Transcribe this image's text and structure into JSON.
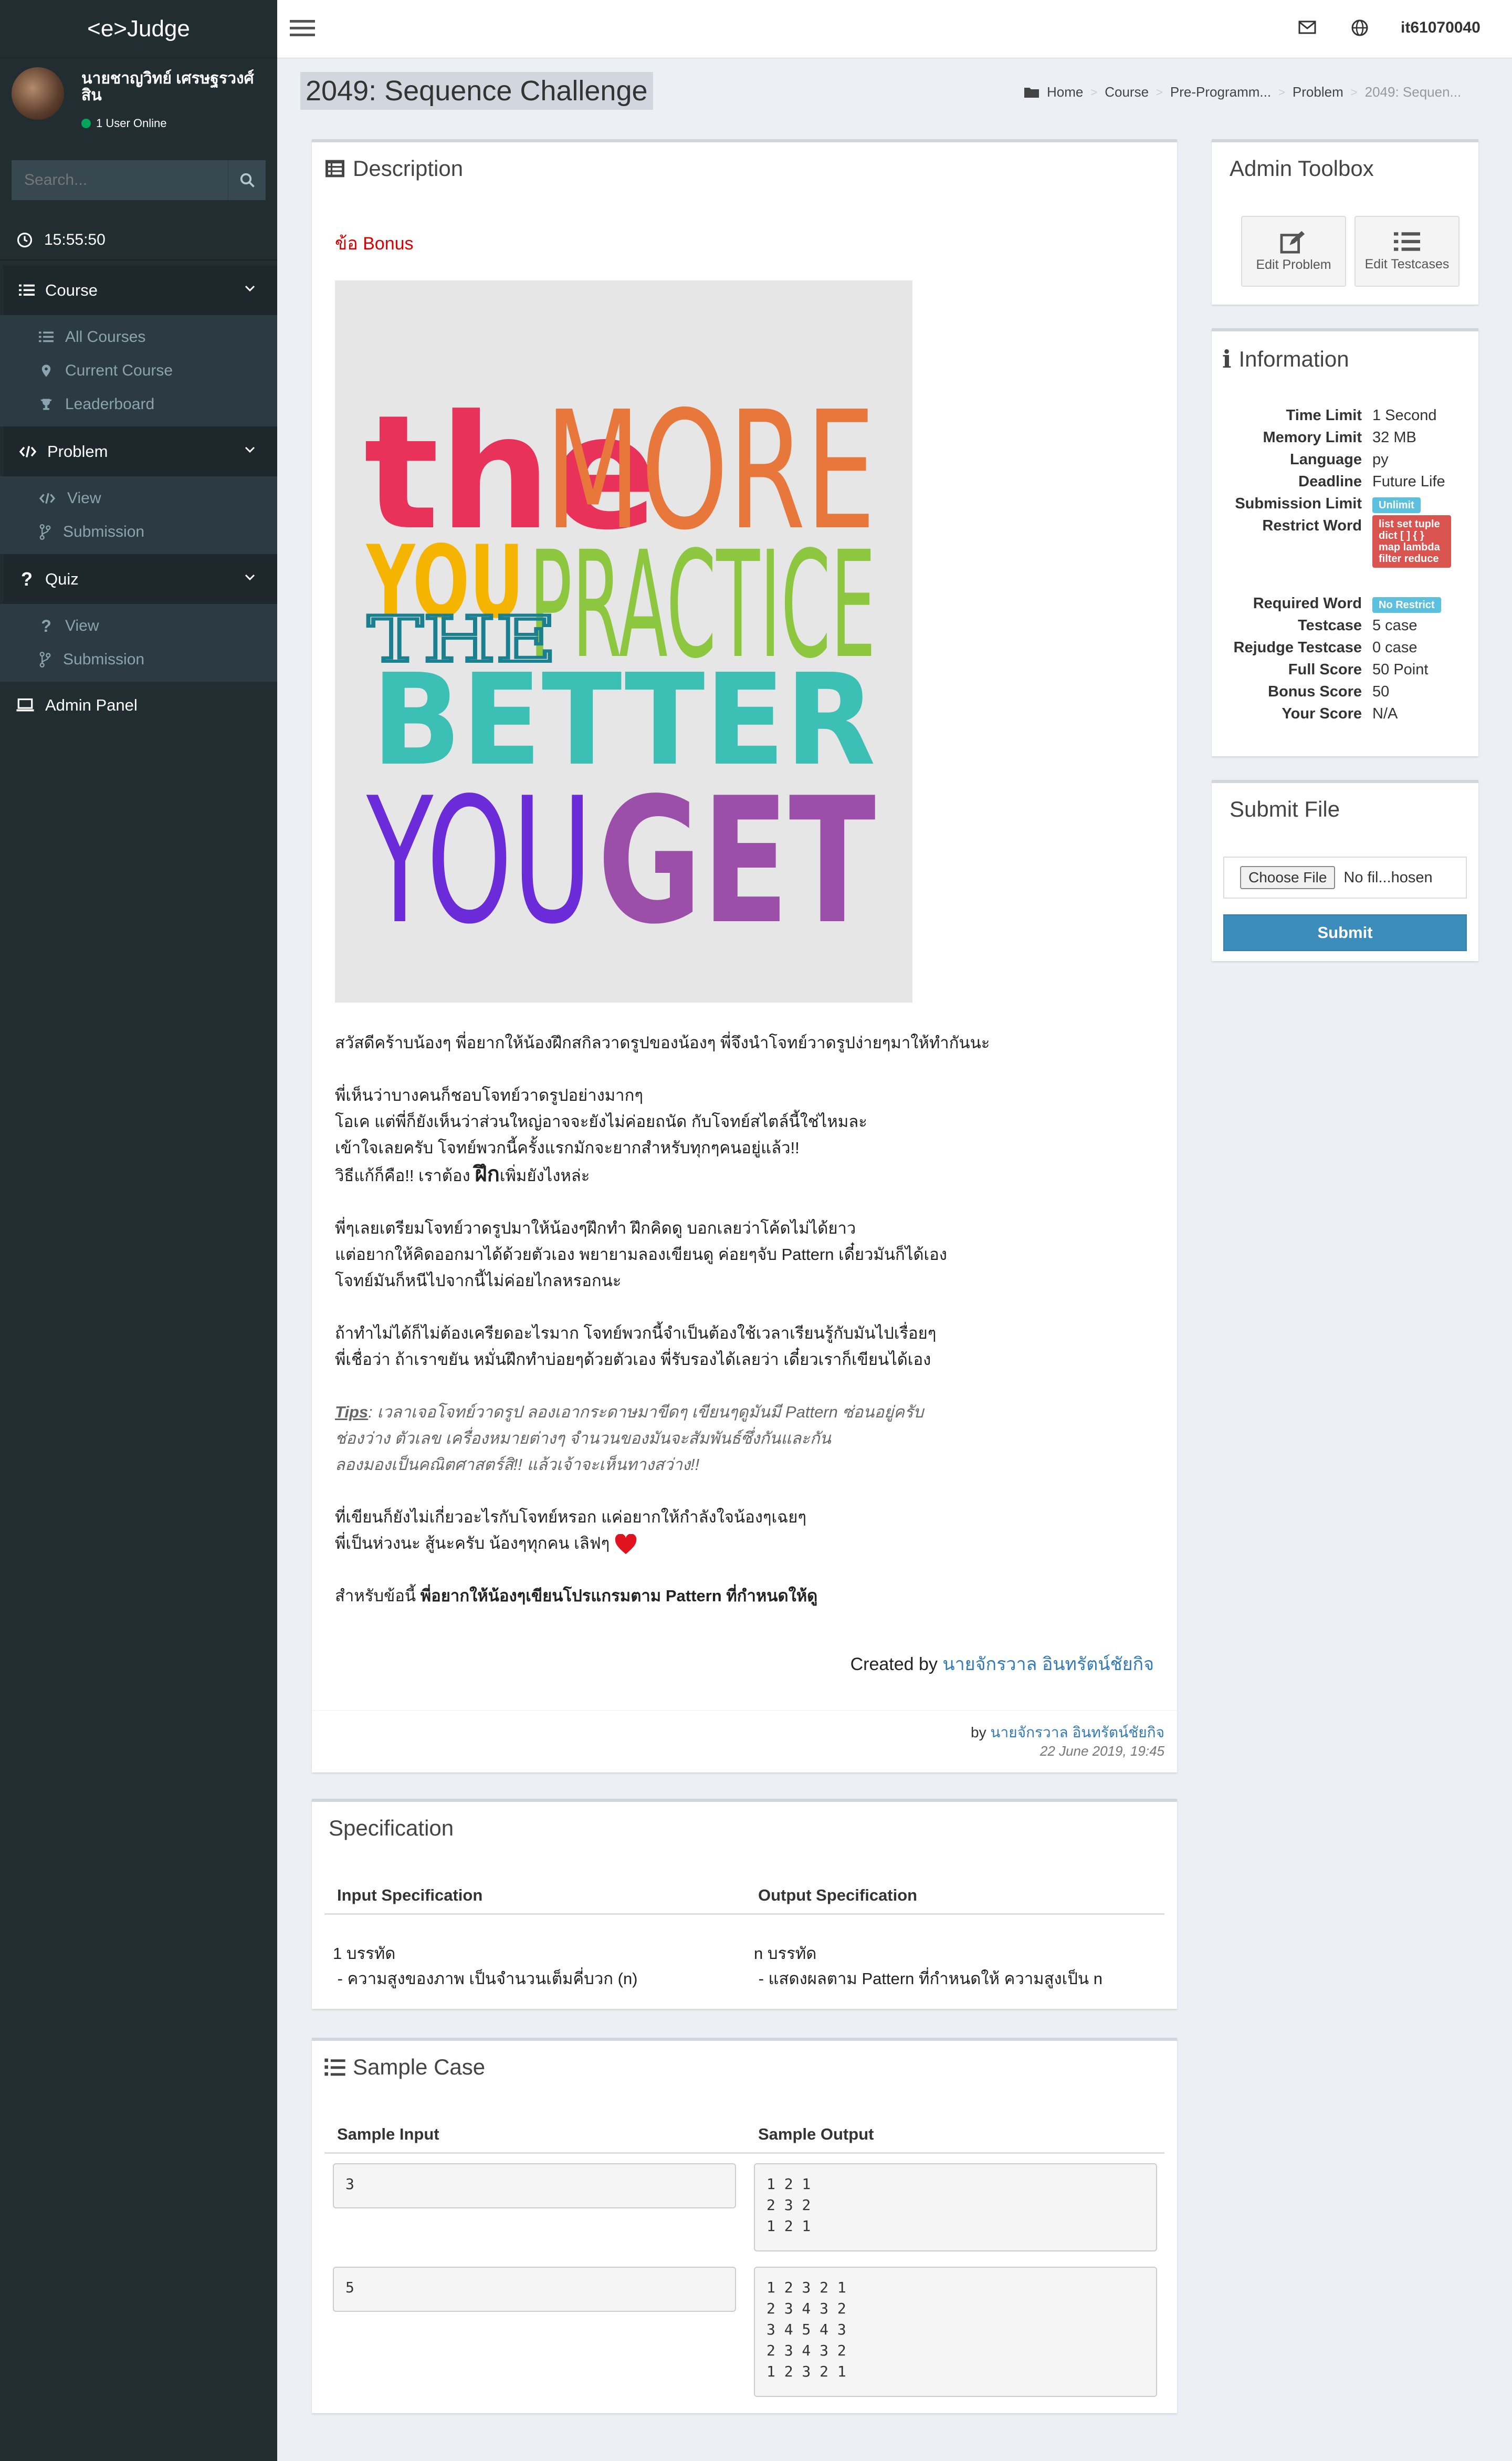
{
  "app": {
    "brand": "<e>Judge"
  },
  "user": {
    "name": "นายชาญวิทย์ เศรษฐรวงศ์สิน",
    "status": "1 User Online"
  },
  "sidebar": {
    "search_placeholder": "Search...",
    "clock": "15:55:50",
    "course": {
      "label": "Course",
      "items": [
        "All Courses",
        "Current Course",
        "Leaderboard"
      ]
    },
    "problem": {
      "label": "Problem",
      "items": [
        "View",
        "Submission"
      ]
    },
    "quiz": {
      "label": "Quiz",
      "items": [
        "View",
        "Submission"
      ]
    },
    "admin": "Admin Panel"
  },
  "topbar": {
    "username": "it61070040"
  },
  "page": {
    "title": "2049: Sequence Challenge"
  },
  "breadcrumb": [
    "Home",
    "Course",
    "Pre-Programm...",
    "Problem",
    "2049: Sequen..."
  ],
  "description": {
    "title": "Description",
    "bonus": "ข้อ Bonus",
    "poster_words": [
      "the",
      "MORE",
      "YOU",
      "PRACTICE",
      "THE",
      "BETTER",
      "YOU",
      "GET"
    ],
    "p1": "สวัสดีคร้าบน้องๆ พี่อยากให้น้องฝึกสกิลวาดรูปของน้องๆ พี่จึงนำโจทย์วาดรูปง่ายๆมาให้ทำกันนะ",
    "p2_1": "พี่เห็นว่าบางคนก็ชอบโจทย์วาดรูปอย่างมากๆ",
    "p2_2": "โอเค แต่พี่ก็ยังเห็นว่าส่วนใหญ่อาจจะยังไม่ค่อยถนัด กับโจทย์สไตล์นี้ใช่ไหมละ",
    "p2_3": "เข้าใจเลยครับ โจทย์พวกนี้ครั้งแรกมักจะยากสำหรับทุกๆคนอยู่แล้ว!!",
    "p2_4a": "วิธีแก้ก็คือ!! เราต้อง ",
    "p2_4b": "ฝึก",
    "p2_4c": "เพิ่มยังไงหล่ะ",
    "p3_1": "พี่ๆเลยเตรียมโจทย์วาดรูปมาให้น้องๆฝึกทำ ฝึกคิดดู บอกเลยว่าโค้ดไม่ได้ยาว",
    "p3_2": "แต่อยากให้คิดออกมาได้ด้วยตัวเอง พยายามลองเขียนดู ค่อยๆจับ Pattern เดี๋ยวมันก็ได้เอง",
    "p3_3": "โจทย์มันก็หนีไปจากนี้ไม่ค่อยไกลหรอกนะ",
    "p4_1": "ถ้าทำไม่ได้ก็ไม่ต้องเครียดอะไรมาก โจทย์พวกนี้จำเป็นต้องใช้เวลาเรียนรู้กับมันไปเรื่อยๆ",
    "p4_2": "พี่เชื่อว่า ถ้าเราขยัน หมั่นฝึกทำบ่อยๆด้วยตัวเอง พี่รับรองได้เลยว่า เดี๋ยวเราก็เขียนได้เอง",
    "tips_label": "Tips",
    "tips_1": ": เวลาเจอโจทย์วาดรูป ลองเอากระดาษมาขีดๆ เขียนๆดูมันมี Pattern ซ่อนอยู่ครับ",
    "tips_2": "ช่องว่าง ตัวเลข เครื่องหมายต่างๆ จำนวนของมันจะสัมพันธ์ซึ่งกันและกัน",
    "tips_3": "ลองมองเป็นคณิตศาสตร์สิ!! แล้วเจ้าจะเห็นทางสว่าง!!",
    "p5_1": "ที่เขียนก็ยังไม่เกี่ยวอะไรกับโจทย์หรอก แค่อยากให้กำลังใจน้องๆเฉยๆ",
    "p5_2": "พี่เป็นห่วงนะ สู้นะครับ น้องๆทุกคน เลิฟๆ",
    "p6_a": "สำหรับข้อนี้ ",
    "p6_b": "พี่อยากให้น้องๆเขียนโปรแกรมตาม Pattern ที่กำหนดให้ดู",
    "created_label": "Created by ",
    "created_name": "นายจักรวาล อินทรัตน์ชัยกิจ",
    "by_label": "by ",
    "by_name": "นายจักรวาล อินทรัตน์ชัยกิจ",
    "date": "22 June 2019, 19:45"
  },
  "specification": {
    "title": "Specification",
    "input_header": "Input Specification",
    "output_header": "Output Specification",
    "input_1": "1 บรรทัด",
    "input_2": " - ความสูงของภาพ เป็นจำนวนเต็มคี่บวก (n)",
    "output_1": "n บรรทัด",
    "output_2": " - แสดงผลตาม Pattern ที่กำหนดให้ ความสูงเป็น n"
  },
  "sample": {
    "title": "Sample Case",
    "input_header": "Sample Input",
    "output_header": "Sample Output",
    "cases": [
      {
        "input": "3",
        "output": "1 2 1\n2 3 2\n1 2 1"
      },
      {
        "input": "5",
        "output": "1 2 3 2 1\n2 3 4 3 2\n3 4 5 4 3\n2 3 4 3 2\n1 2 3 2 1"
      }
    ]
  },
  "admin_toolbox": {
    "title": "Admin Toolbox",
    "edit_problem": "Edit Problem",
    "edit_testcases": "Edit Testcases"
  },
  "information": {
    "title": "Information",
    "rows": [
      {
        "k": "Time Limit",
        "v": "1 Second"
      },
      {
        "k": "Memory Limit",
        "v": "32 MB"
      },
      {
        "k": "Language",
        "v": "py"
      },
      {
        "k": "Deadline",
        "v": "Future Life"
      },
      {
        "k": "Submission Limit",
        "v": "Unlimit"
      },
      {
        "k": "Restrict Word",
        "v": "list set tuple dict [ ] { } map lambda filter reduce"
      },
      {
        "k": "Required Word",
        "v": "No Restrict"
      },
      {
        "k": "Testcase",
        "v": "5 case"
      },
      {
        "k": "Rejudge Testcase",
        "v": "0 case"
      },
      {
        "k": "Full Score",
        "v": "50 Point"
      },
      {
        "k": "Bonus Score",
        "v": "50"
      },
      {
        "k": "Your Score",
        "v": "N/A"
      }
    ]
  },
  "submit": {
    "title": "Submit File",
    "choose": "Choose File",
    "no_file": "No fil...hosen",
    "button": "Submit"
  }
}
